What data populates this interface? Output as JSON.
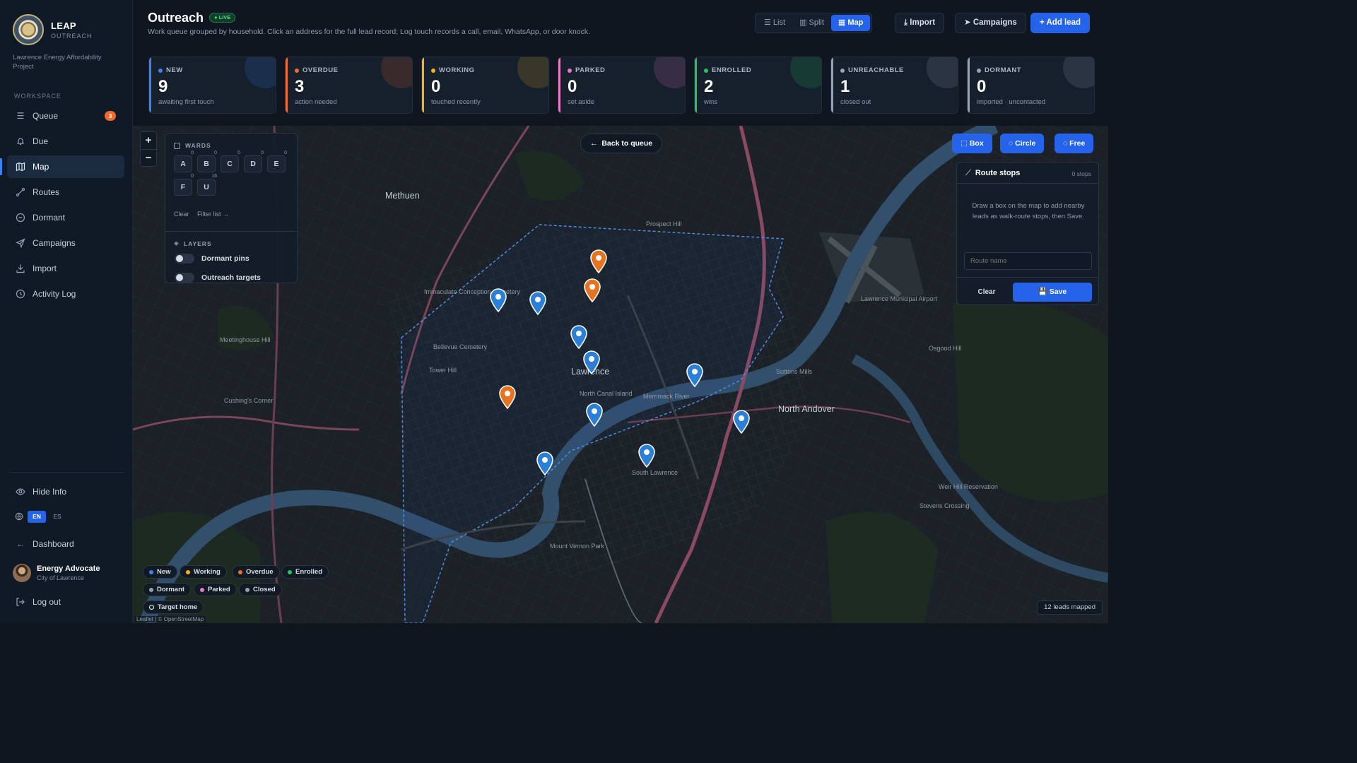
{
  "app": {
    "name": "LEAP",
    "subtitle": "OUTREACH",
    "project": "Lawrence Energy Affordability Project"
  },
  "sidebar": {
    "section": "WORKSPACE",
    "items": [
      {
        "label": "Queue",
        "icon": "list-icon",
        "badge": "3"
      },
      {
        "label": "Due",
        "icon": "bell-icon"
      },
      {
        "label": "Map",
        "icon": "map-icon",
        "active": true
      },
      {
        "label": "Routes",
        "icon": "route-icon"
      },
      {
        "label": "Dormant",
        "icon": "minus-circle-icon"
      },
      {
        "label": "Campaigns",
        "icon": "send-icon"
      },
      {
        "label": "Import",
        "icon": "download-icon"
      },
      {
        "label": "Activity Log",
        "icon": "clock-icon"
      }
    ],
    "hide_info": "Hide Info",
    "lang": [
      "EN",
      "ES"
    ],
    "dashboard": "Dashboard",
    "user": {
      "name": "Energy Advocate",
      "role": "City of Lawrence"
    },
    "logout": "Log out"
  },
  "header": {
    "title": "Outreach",
    "live": "LIVE",
    "subtitle": "Work queue grouped by household. Click an address for the full lead record; Log touch records a call, email, WhatsApp, or door knock.",
    "views": [
      "List",
      "Split",
      "Map"
    ],
    "active_view": "Map",
    "import": "Import",
    "campaigns": "Campaigns",
    "add_lead": "Add lead"
  },
  "stats": [
    {
      "label": "NEW",
      "value": "9",
      "sub": "awaiting first touch",
      "color": "#3b82f6"
    },
    {
      "label": "OVERDUE",
      "value": "3",
      "sub": "action needed",
      "color": "#f26b2e"
    },
    {
      "label": "WORKING",
      "value": "0",
      "sub": "touched recently",
      "color": "#f5b316"
    },
    {
      "label": "PARKED",
      "value": "0",
      "sub": "set aside",
      "color": "#e879c9"
    },
    {
      "label": "ENROLLED",
      "value": "2",
      "sub": "wins",
      "color": "#22c55e"
    },
    {
      "label": "UNREACHABLE",
      "value": "1",
      "sub": "closed out",
      "color": "#94a3b8"
    },
    {
      "label": "DORMANT",
      "value": "0",
      "sub": "imported · uncontacted",
      "color": "#94a3b8"
    }
  ],
  "map": {
    "zoom_in": "+",
    "zoom_out": "−",
    "wards_title": "WARDS",
    "wards": [
      {
        "label": "A",
        "count": "0"
      },
      {
        "label": "B",
        "count": "0"
      },
      {
        "label": "C",
        "count": "0"
      },
      {
        "label": "D",
        "count": "0"
      },
      {
        "label": "E",
        "count": "0"
      },
      {
        "label": "F",
        "count": "0"
      },
      {
        "label": "U",
        "count": "16"
      }
    ],
    "wards_clear": "Clear",
    "wards_filter": "Filter list →",
    "layers_title": "LAYERS",
    "layers": [
      "Dormant pins",
      "Outreach targets"
    ],
    "back_to_queue": "Back to queue",
    "select_modes": [
      "Box",
      "Circle",
      "Free"
    ],
    "route": {
      "title": "Route stops",
      "count": "0 stops",
      "help": "Draw a box on the map to add nearby leads as walk-route stops, then Save.",
      "placeholder": "Route name",
      "clear": "Clear",
      "save": "Save"
    },
    "legend": [
      {
        "label": "New",
        "color": "#3b82f6"
      },
      {
        "label": "Working",
        "color": "#f5b316"
      },
      {
        "label": "Overdue",
        "color": "#f26b2e"
      },
      {
        "label": "Enrolled",
        "color": "#22c55e"
      },
      {
        "label": "Dormant",
        "color": "#94a3b8"
      },
      {
        "label": "Parked",
        "color": "#e879c9"
      },
      {
        "label": "Closed",
        "color": "#94a3b8"
      },
      {
        "label": "Target home",
        "color": "#ffffff"
      }
    ],
    "attribution": "Leaflet | © OpenStreetMap",
    "leads_mapped": "12 leads mapped",
    "places": [
      {
        "label": "Methuen",
        "big": true
      },
      {
        "label": "Lawrence",
        "big": true
      },
      {
        "label": "North Andover",
        "big": true
      },
      {
        "label": "South Lawrence"
      },
      {
        "label": "Prospect Hill"
      },
      {
        "label": "Tower Hill"
      },
      {
        "label": "Mount Vernon Park"
      },
      {
        "label": "Meetinghouse Hill"
      },
      {
        "label": "Lawrence Municipal Airport"
      },
      {
        "label": "Osgood Hill"
      },
      {
        "label": "Suttons Mills"
      },
      {
        "label": "Cushing's Corner"
      },
      {
        "label": "Stevens Crossing"
      },
      {
        "label": "Bellevue Cemetery"
      },
      {
        "label": "Immaculate Conception Cemetery"
      },
      {
        "label": "North Canal Island"
      },
      {
        "label": "Merrimack River"
      },
      {
        "label": "Weir Hill Reservation"
      }
    ],
    "pins": [
      {
        "status": "overdue"
      },
      {
        "status": "overdue"
      },
      {
        "status": "new"
      },
      {
        "status": "new"
      },
      {
        "status": "new"
      },
      {
        "status": "new"
      },
      {
        "status": "new"
      },
      {
        "status": "new"
      },
      {
        "status": "overdue"
      },
      {
        "status": "new"
      },
      {
        "status": "new"
      },
      {
        "status": "new"
      }
    ]
  }
}
